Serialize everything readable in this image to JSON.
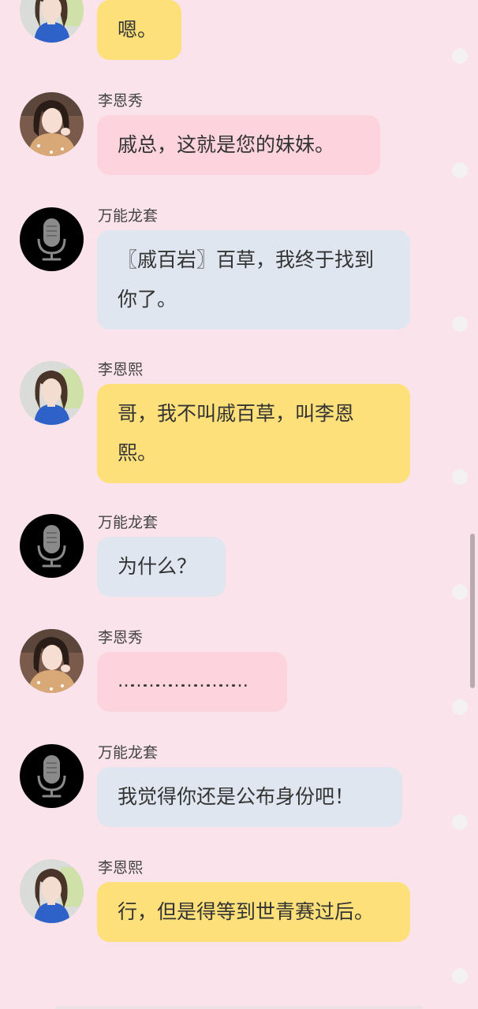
{
  "colors": {
    "background": "#fae3ea",
    "bubble_yellow": "#fee07a",
    "bubble_pink": "#fdd3de",
    "bubble_blue": "#e0e6ef",
    "avatar_black": "#000000"
  },
  "messages": [
    {
      "sender": "",
      "text": "嗯。",
      "avatar": "girl-blue-shirt-avatar",
      "bubble_color": "yellow"
    },
    {
      "sender": "李恩秀",
      "text": "戚总，这就是您的妹妹。",
      "avatar": "girl-orange-sweater-avatar",
      "bubble_color": "pink"
    },
    {
      "sender": "万能龙套",
      "text": "〖戚百岩〗百草，我终于找到你了。",
      "avatar": "microphone-icon",
      "bubble_color": "blue"
    },
    {
      "sender": "李恩熙",
      "text": "哥，我不叫戚百草，叫李恩熙。",
      "avatar": "girl-blue-shirt-avatar",
      "bubble_color": "yellow"
    },
    {
      "sender": "万能龙套",
      "text": "为什么？",
      "avatar": "microphone-icon",
      "bubble_color": "blue"
    },
    {
      "sender": "李恩秀",
      "text": "…………………………",
      "avatar": "girl-orange-sweater-avatar",
      "bubble_color": "pink"
    },
    {
      "sender": "万能龙套",
      "text": "我觉得你还是公布身份吧！",
      "avatar": "microphone-icon",
      "bubble_color": "blue"
    },
    {
      "sender": "李恩熙",
      "text": "行，但是得等到世青赛过后。",
      "avatar": "girl-blue-shirt-avatar",
      "bubble_color": "yellow"
    }
  ]
}
